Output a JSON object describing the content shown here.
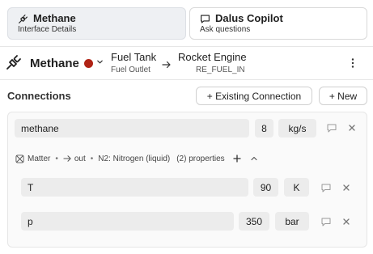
{
  "tabs": [
    {
      "title": "Methane",
      "subtitle": "Interface Details",
      "icon": "plug-icon",
      "active": true
    },
    {
      "title": "Dalus Copilot",
      "subtitle": "Ask questions",
      "icon": "chat-icon",
      "active": false
    }
  ],
  "header": {
    "name": "Methane",
    "color": "#b02315",
    "from": {
      "name": "Fuel Tank",
      "port": "Fuel Outlet"
    },
    "to": {
      "name": "Rocket Engine",
      "port": "RE_FUEL_IN"
    }
  },
  "connections": {
    "title": "Connections",
    "existing_label": "+ Existing Connection",
    "new_label": "+ New"
  },
  "connection": {
    "name": "methane",
    "value": "8",
    "unit": "kg/s",
    "meta": {
      "kind": "Matter",
      "direction": "out",
      "material": "N2: Nitrogen (liquid)",
      "properties": "(2) properties"
    },
    "properties": [
      {
        "name": "T",
        "value": "90",
        "unit": "K"
      },
      {
        "name": "p",
        "value": "350",
        "unit": "bar"
      }
    ]
  }
}
